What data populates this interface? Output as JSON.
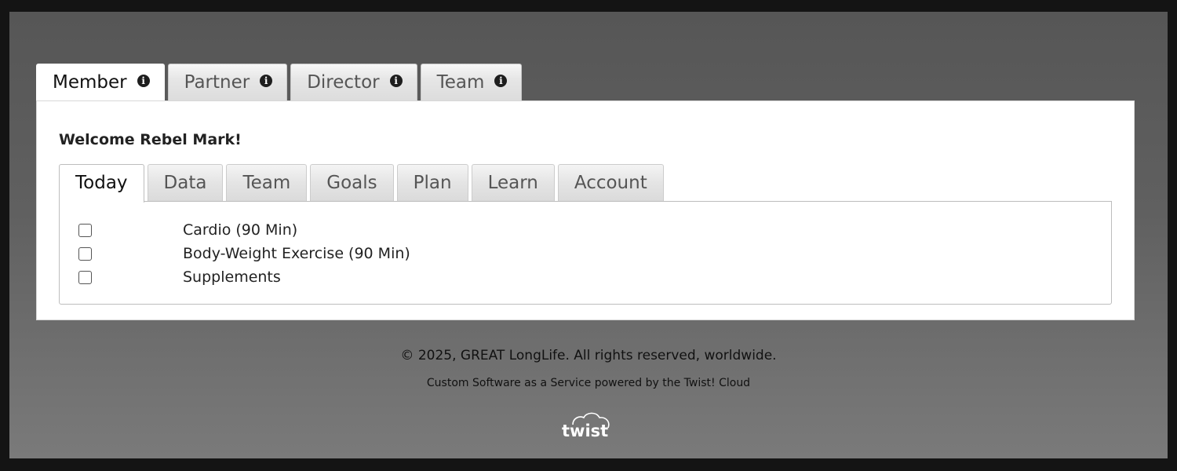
{
  "role_tabs": [
    {
      "label": "Member",
      "active": true
    },
    {
      "label": "Partner",
      "active": false
    },
    {
      "label": "Director",
      "active": false
    },
    {
      "label": "Team",
      "active": false
    }
  ],
  "welcome": "Welcome Rebel Mark!",
  "sub_tabs": [
    {
      "label": "Today",
      "active": true
    },
    {
      "label": "Data",
      "active": false
    },
    {
      "label": "Team",
      "active": false
    },
    {
      "label": "Goals",
      "active": false
    },
    {
      "label": "Plan",
      "active": false
    },
    {
      "label": "Learn",
      "active": false
    },
    {
      "label": "Account",
      "active": false
    }
  ],
  "tasks": [
    {
      "label": "Cardio (90 Min)",
      "checked": false
    },
    {
      "label": "Body-Weight Exercise (90 Min)",
      "checked": false
    },
    {
      "label": "Supplements",
      "checked": false
    }
  ],
  "footer": {
    "copyright": "© 2025, GREAT LongLife. All rights reserved, worldwide.",
    "powered_by": "Custom Software as a Service powered by the Twist! Cloud"
  },
  "logo": {
    "text": "twist",
    "icon": "cloud-logo-icon"
  }
}
